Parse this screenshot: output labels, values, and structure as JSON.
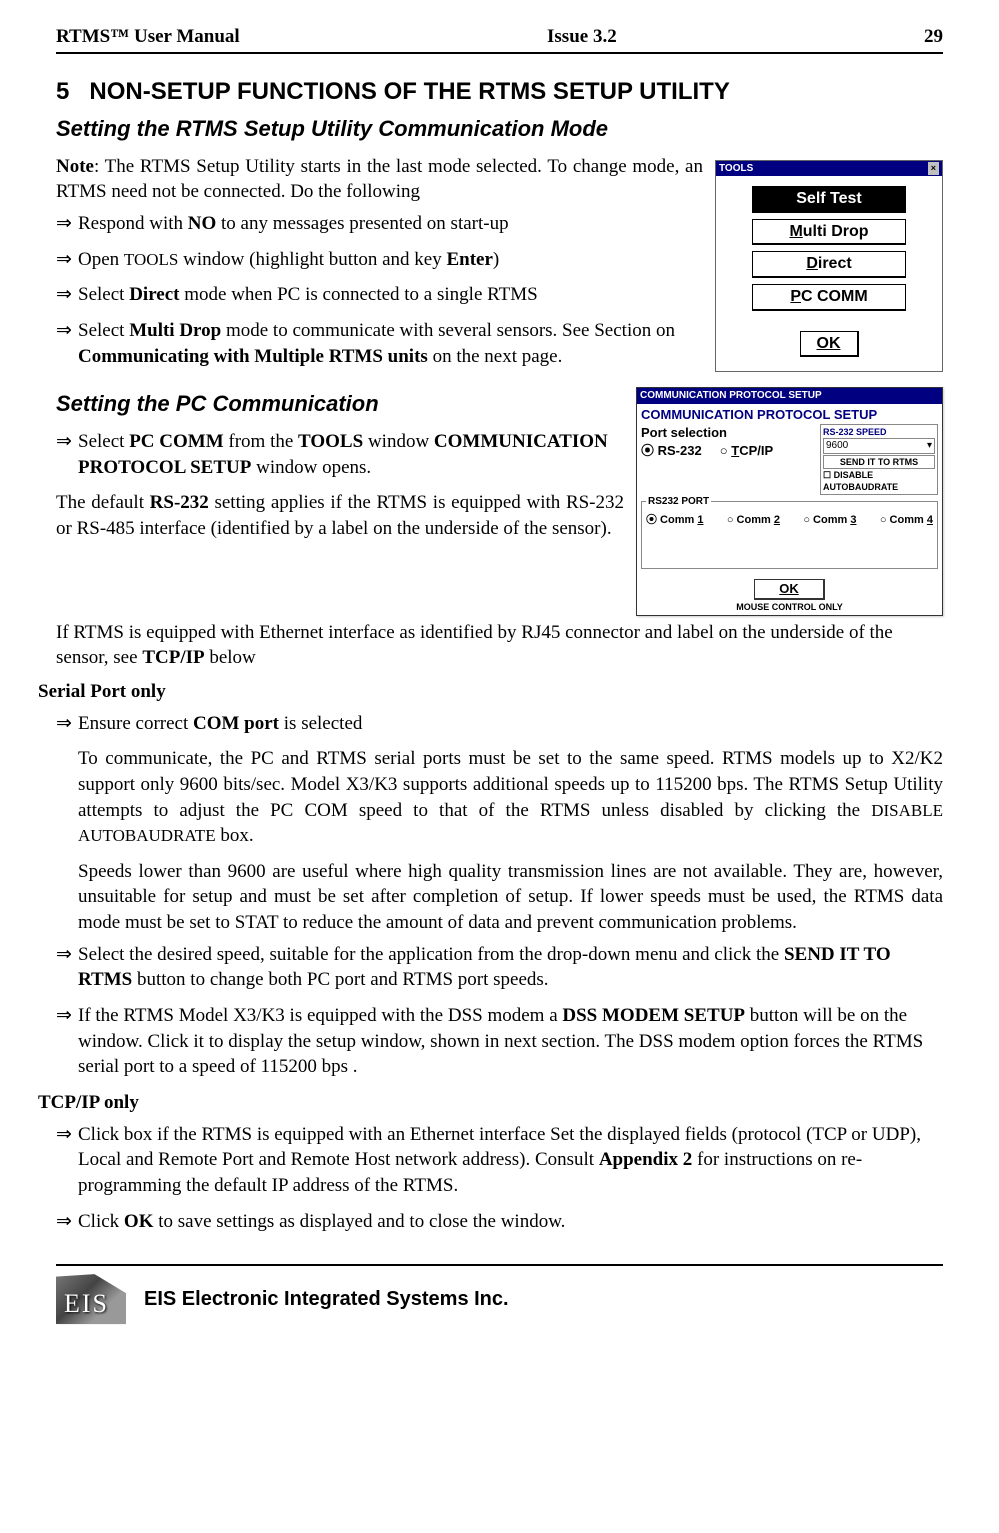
{
  "header": {
    "left": "RTMS™ User Manual",
    "center": "Issue 3.2",
    "right": "29"
  },
  "section": {
    "num": "5",
    "title": "NON-SETUP FUNCTIONS OF THE RTMS SETUP UTILITY",
    "sub1": "Setting the RTMS Setup Utility Communication Mode",
    "sub2": "Setting the PC Communication"
  },
  "note": {
    "prefix": "Note",
    "line1": ": The RTMS Setup Utility starts in the last mode selected. To change mode, an RTMS need not be connected. Do the following"
  },
  "list1": {
    "a": {
      "pre": "Respond with ",
      "b": "NO",
      "post": " to any  messages presented on start-up"
    },
    "b": {
      "pre": "Open ",
      "sc": "TOOLS",
      "mid": " window  (highlight button and key ",
      "b": "Enter",
      "post": ")"
    },
    "c": {
      "pre": "Select ",
      "b": "Direct",
      "post": " mode when PC is connected to a single RTMS"
    },
    "d": {
      "pre": "Select ",
      "b": "Multi Drop",
      "mid": " mode to communicate with several sensors. See Section on ",
      "b2": "Communicating with Multiple RTMS units",
      "post": " on the next page."
    }
  },
  "tools": {
    "title": "TOOLS",
    "items": [
      "Self Test",
      "Multi Drop",
      "Direct",
      "PC COMM"
    ],
    "ok": "OK"
  },
  "comm": {
    "title": "COMMUNICATION PROTOCOL SETUP",
    "heading": "COMMUNICATION PROTOCOL SETUP",
    "portsel": "Port selection",
    "rs232": "RS-232",
    "tcpip": "TCP/IP",
    "speedlabel": "RS-232 SPEED",
    "speed": "9600",
    "send": "SEND IT TO RTMS",
    "disable": "DISABLE AUTOBAUDRATE",
    "portbox": "RS232 PORT",
    "ports": [
      "Comm 1",
      "Comm 2",
      "Comm 3",
      "Comm 4"
    ],
    "ok": "OK",
    "mouse": "MOUSE CONTROL ONLY"
  },
  "list2": {
    "a": {
      "pre": "Select ",
      "b1": "PC COMM",
      "mid1": " from the ",
      "b2": "TOOLS",
      "mid2": " window ",
      "b3": "COMMUNICATION PROTOCOL SETUP",
      "post": "  window opens."
    }
  },
  "para": {
    "rs232default": {
      "pre": "The default ",
      "b": "RS-232",
      "post": " setting applies if the RTMS is equipped with RS-232 or RS-485 interface (identified by a label on the underside of the sensor)."
    },
    "eth": {
      "pre": "If RTMS is equipped with Ethernet interface as identified by RJ45 connector and label on the underside of the sensor, see ",
      "b": "TCP/IP",
      "post": " below"
    }
  },
  "serial": {
    "head": "Serial Port only",
    "a": {
      "pre": "Ensure correct ",
      "b": "COM port",
      "post": " is selected"
    },
    "p1": {
      "pre": "To communicate, the PC and RTMS serial ports must be set to the same speed. RTMS models up to X2/K2 support only 9600 bits/sec. Model X3/K3 supports additional speeds up to 115200 bps.  The RTMS Setup Utility attempts to adjust the PC COM speed to that of the RTMS unless disabled by clicking the ",
      "sc": "DISABLE AUTOBAUDRATE",
      "post": "  box."
    },
    "p2": "Speeds lower than 9600 are useful where high quality transmission lines are not available. They are, however, unsuitable for setup and must be set after completion of setup. If lower speeds must be used, the RTMS data mode must be set to STAT to reduce the amount of data and prevent communication problems.",
    "b": {
      "pre": "Select the desired speed, suitable for the application from the drop-down menu and click the ",
      "bold": "SEND IT TO RTMS",
      "post": " button to change both PC port and RTMS port speeds."
    },
    "c": {
      "pre": "If the RTMS Model X3/K3 is equipped with the DSS modem a ",
      "bold": "DSS MODEM SETUP",
      "post": " button will be on the window.  Click it to display the setup window, shown in next section. The DSS modem option  forces the RTMS serial  port to a speed of  115200 bps ."
    }
  },
  "tcpip": {
    "head": "TCP/IP only",
    "a": {
      "pre": "Click box if the RTMS is equipped with an Ethernet interface Set the displayed fields (protocol (TCP or UDP), Local and Remote Port and Remote Host network address).  Consult ",
      "b": "Appendix 2",
      "post": " for instructions on re-programming the default IP address of the RTMS."
    },
    "b": {
      "pre": "Click ",
      "b": "OK",
      "post": " to save settings as displayed and to close the window."
    }
  },
  "footer": {
    "logo": "EIS",
    "company": "EIS Electronic Integrated Systems Inc."
  }
}
